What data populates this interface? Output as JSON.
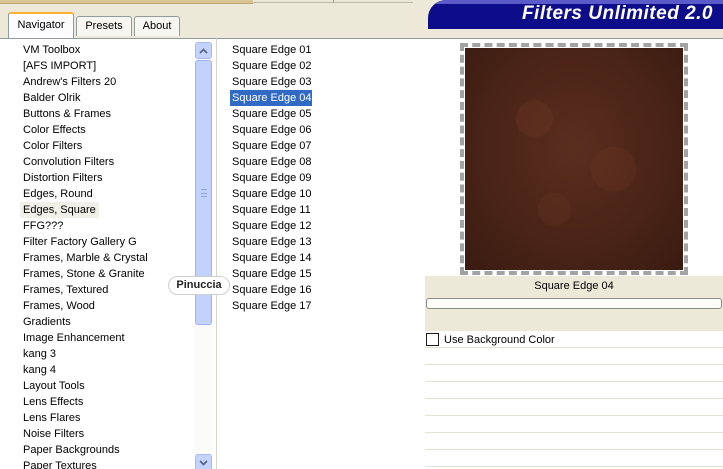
{
  "tabs": [
    {
      "label": "Navigator",
      "active": true
    },
    {
      "label": "Presets",
      "active": false
    },
    {
      "label": "About",
      "active": false
    }
  ],
  "banner": {
    "title": "Filters Unlimited 2.0",
    "color": "#0d0d8a"
  },
  "categories": [
    "VM Toolbox",
    "[AFS IMPORT]",
    "Andrew's Filters 20",
    "Balder Olrik",
    "Buttons & Frames",
    "Color Effects",
    "Color Filters",
    "Convolution Filters",
    "Distortion Filters",
    "Edges, Round",
    "Edges, Square",
    "FFG???",
    "Filter Factory Gallery G",
    "Frames, Marble & Crystal",
    "Frames, Stone & Granite",
    "Frames, Textured",
    "Frames, Wood",
    "Gradients",
    "Image Enhancement",
    "kang 3",
    "kang 4",
    "Layout Tools",
    "Lens Effects",
    "Lens Flares",
    "Noise Filters",
    "Paper Backgrounds",
    "Paper Textures"
  ],
  "selected_category": "Edges, Square",
  "filters": [
    "Square Edge 01",
    "Square Edge 02",
    "Square Edge 03",
    "Square Edge 04",
    "Square Edge 05",
    "Square Edge 06",
    "Square Edge 07",
    "Square Edge 08",
    "Square Edge 09",
    "Square Edge 10",
    "Square Edge 11",
    "Square Edge 12",
    "Square Edge 13",
    "Square Edge 14",
    "Square Edge 15",
    "Square Edge 16",
    "Square Edge 17"
  ],
  "selected_filter": "Square Edge 04",
  "watermark": "Pinuccia",
  "preview": {
    "caption": "Square Edge 04"
  },
  "progress": {
    "fraction": 0.0,
    "color": "#3da33d"
  },
  "options": {
    "use_background_color": {
      "label": "Use Background Color",
      "checked": false
    }
  },
  "colors": {
    "selection": "#316ac5",
    "tab_highlight": "#f9b232",
    "scrollbar": "#c1d2fc"
  }
}
